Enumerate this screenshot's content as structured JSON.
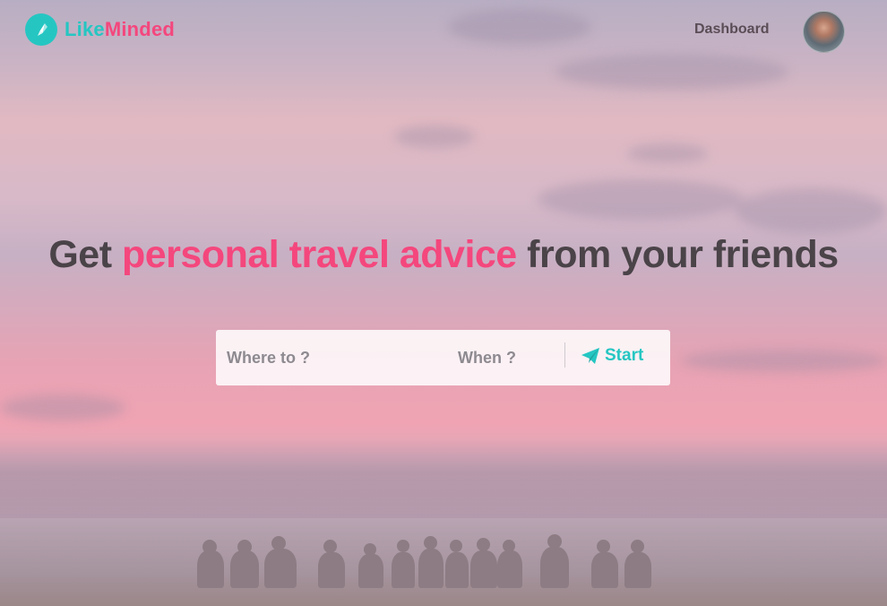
{
  "brand": {
    "name_part1": "Like",
    "name_part2": "Minded",
    "color_primary": "#25c6c2",
    "color_accent": "#f4477d"
  },
  "nav": {
    "dashboard_label": "Dashboard"
  },
  "hero": {
    "headline_part1": "Get ",
    "headline_accent": "personal travel advice",
    "headline_part2": " from your friends"
  },
  "search": {
    "where_placeholder": "Where to ?",
    "when_placeholder": "When ?",
    "start_label": "Start"
  },
  "icons": {
    "logo": "compass-icon",
    "start": "paper-plane-icon"
  }
}
